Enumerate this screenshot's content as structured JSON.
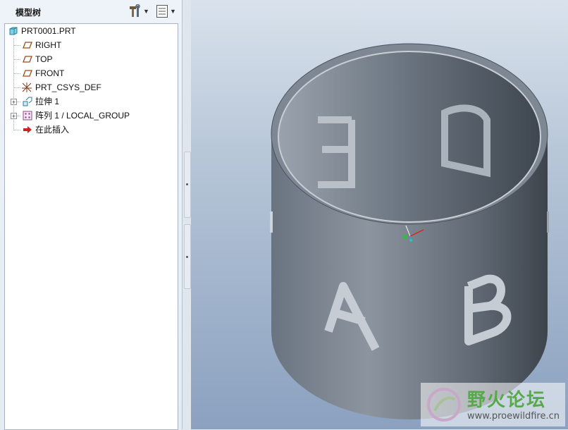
{
  "panel": {
    "title": "模型树",
    "settings_icon": "hammer-wrench-icon",
    "show_icon": "list-icon"
  },
  "tree": {
    "items": [
      {
        "label": "PRT0001.PRT",
        "icon": "part-icon"
      },
      {
        "label": "RIGHT",
        "icon": "datum-plane-icon"
      },
      {
        "label": "TOP",
        "icon": "datum-plane-icon"
      },
      {
        "label": "FRONT",
        "icon": "datum-plane-icon"
      },
      {
        "label": "PRT_CSYS_DEF",
        "icon": "coordinate-system-icon"
      },
      {
        "label": "拉伸 1",
        "icon": "extrude-icon",
        "expandable": true
      },
      {
        "label": "阵列 1 / LOCAL_GROUP",
        "icon": "pattern-icon",
        "expandable": true
      },
      {
        "label": "在此插入",
        "icon": "insert-here-arrow-icon"
      }
    ]
  },
  "viewport": {
    "model_letters": [
      "A",
      "B",
      "E",
      "D"
    ],
    "colors": {
      "model": "#6f7a86",
      "background_top": "#d9e2ec",
      "background_bottom": "#8ba1c0"
    }
  },
  "watermark": {
    "title": "野火论坛",
    "url": "www.proewildfire.cn"
  }
}
